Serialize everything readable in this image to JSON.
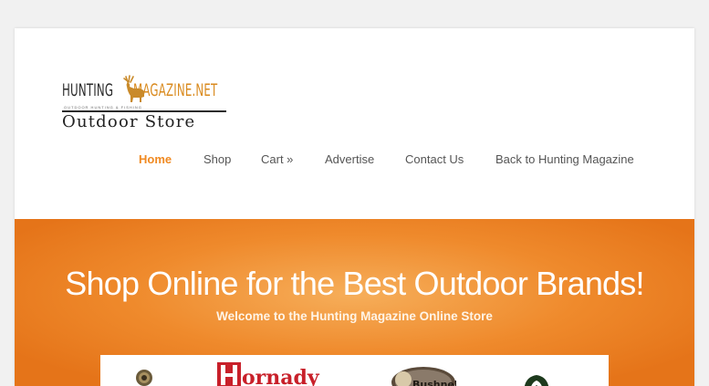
{
  "logo": {
    "word1": "HUNTING",
    "word2": "MAGAZINE.NET",
    "tagline": "OUTDOOR HUNTING & FISHING",
    "subtitle": "Outdoor Store"
  },
  "nav": {
    "items": [
      {
        "label": "Home",
        "active": true
      },
      {
        "label": "Shop",
        "active": false
      },
      {
        "label": "Cart »",
        "active": false
      },
      {
        "label": "Advertise",
        "active": false
      },
      {
        "label": "Contact Us",
        "active": false
      },
      {
        "label": "Back to Hunting Magazine",
        "active": false
      }
    ]
  },
  "hero": {
    "title": "Shop Online for the Best Outdoor Brands!",
    "subtitle": "Welcome to the Hunting Magazine Online Store"
  },
  "brands": {
    "items": [
      {
        "name": "emblem-logo"
      },
      {
        "name": "Hornady"
      },
      {
        "name": "Bushnell"
      },
      {
        "name": "Mossy Oak"
      }
    ]
  },
  "colors": {
    "accent": "#f08a22",
    "hero_light": "#f6ae5a",
    "hero_dark": "#e57419",
    "logo_orange": "#d98a1e",
    "hornady_red": "#c8202a"
  }
}
